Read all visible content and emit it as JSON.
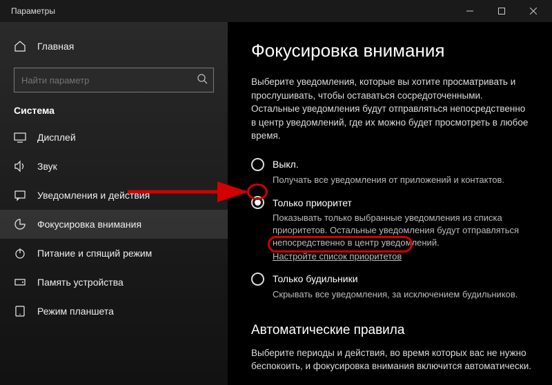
{
  "window": {
    "title": "Параметры"
  },
  "sidebar": {
    "home": "Главная",
    "search_placeholder": "Найти параметр",
    "section": "Система",
    "items": [
      {
        "label": "Дисплей",
        "icon": "display"
      },
      {
        "label": "Звук",
        "icon": "sound"
      },
      {
        "label": "Уведомления и действия",
        "icon": "notifications"
      },
      {
        "label": "Фокусировка внимания",
        "icon": "focus",
        "selected": true
      },
      {
        "label": "Питание и спящий режим",
        "icon": "power"
      },
      {
        "label": "Память устройства",
        "icon": "storage"
      },
      {
        "label": "Режим планшета",
        "icon": "tablet"
      }
    ]
  },
  "main": {
    "heading": "Фокусировка внимания",
    "description": "Выберите уведомления, которые вы хотите просматривать и прослушивать, чтобы оставаться сосредоточенными. Остальные уведомления будут отправляться непосредственно в центр уведомлений, где их можно будет просмотреть в любое время.",
    "options": [
      {
        "label": "Выкл.",
        "desc": "Получать все уведомления от приложений и контактов.",
        "checked": false
      },
      {
        "label": "Только приоритет",
        "desc": "Показывать только выбранные уведомления из списка приоритетов. Остальные уведомления будут отправляться непосредственно в центр уведомлений.",
        "link": "Настройте список приоритетов",
        "checked": true
      },
      {
        "label": "Только будильники",
        "desc": "Скрывать все уведомления, за исключением будильников.",
        "checked": false
      }
    ],
    "rules_heading": "Автоматические правила",
    "rules_desc": "Выберите периоды и действия, во время которых вас не нужно беспокоить, и фокусировка внимания включится автоматически."
  }
}
